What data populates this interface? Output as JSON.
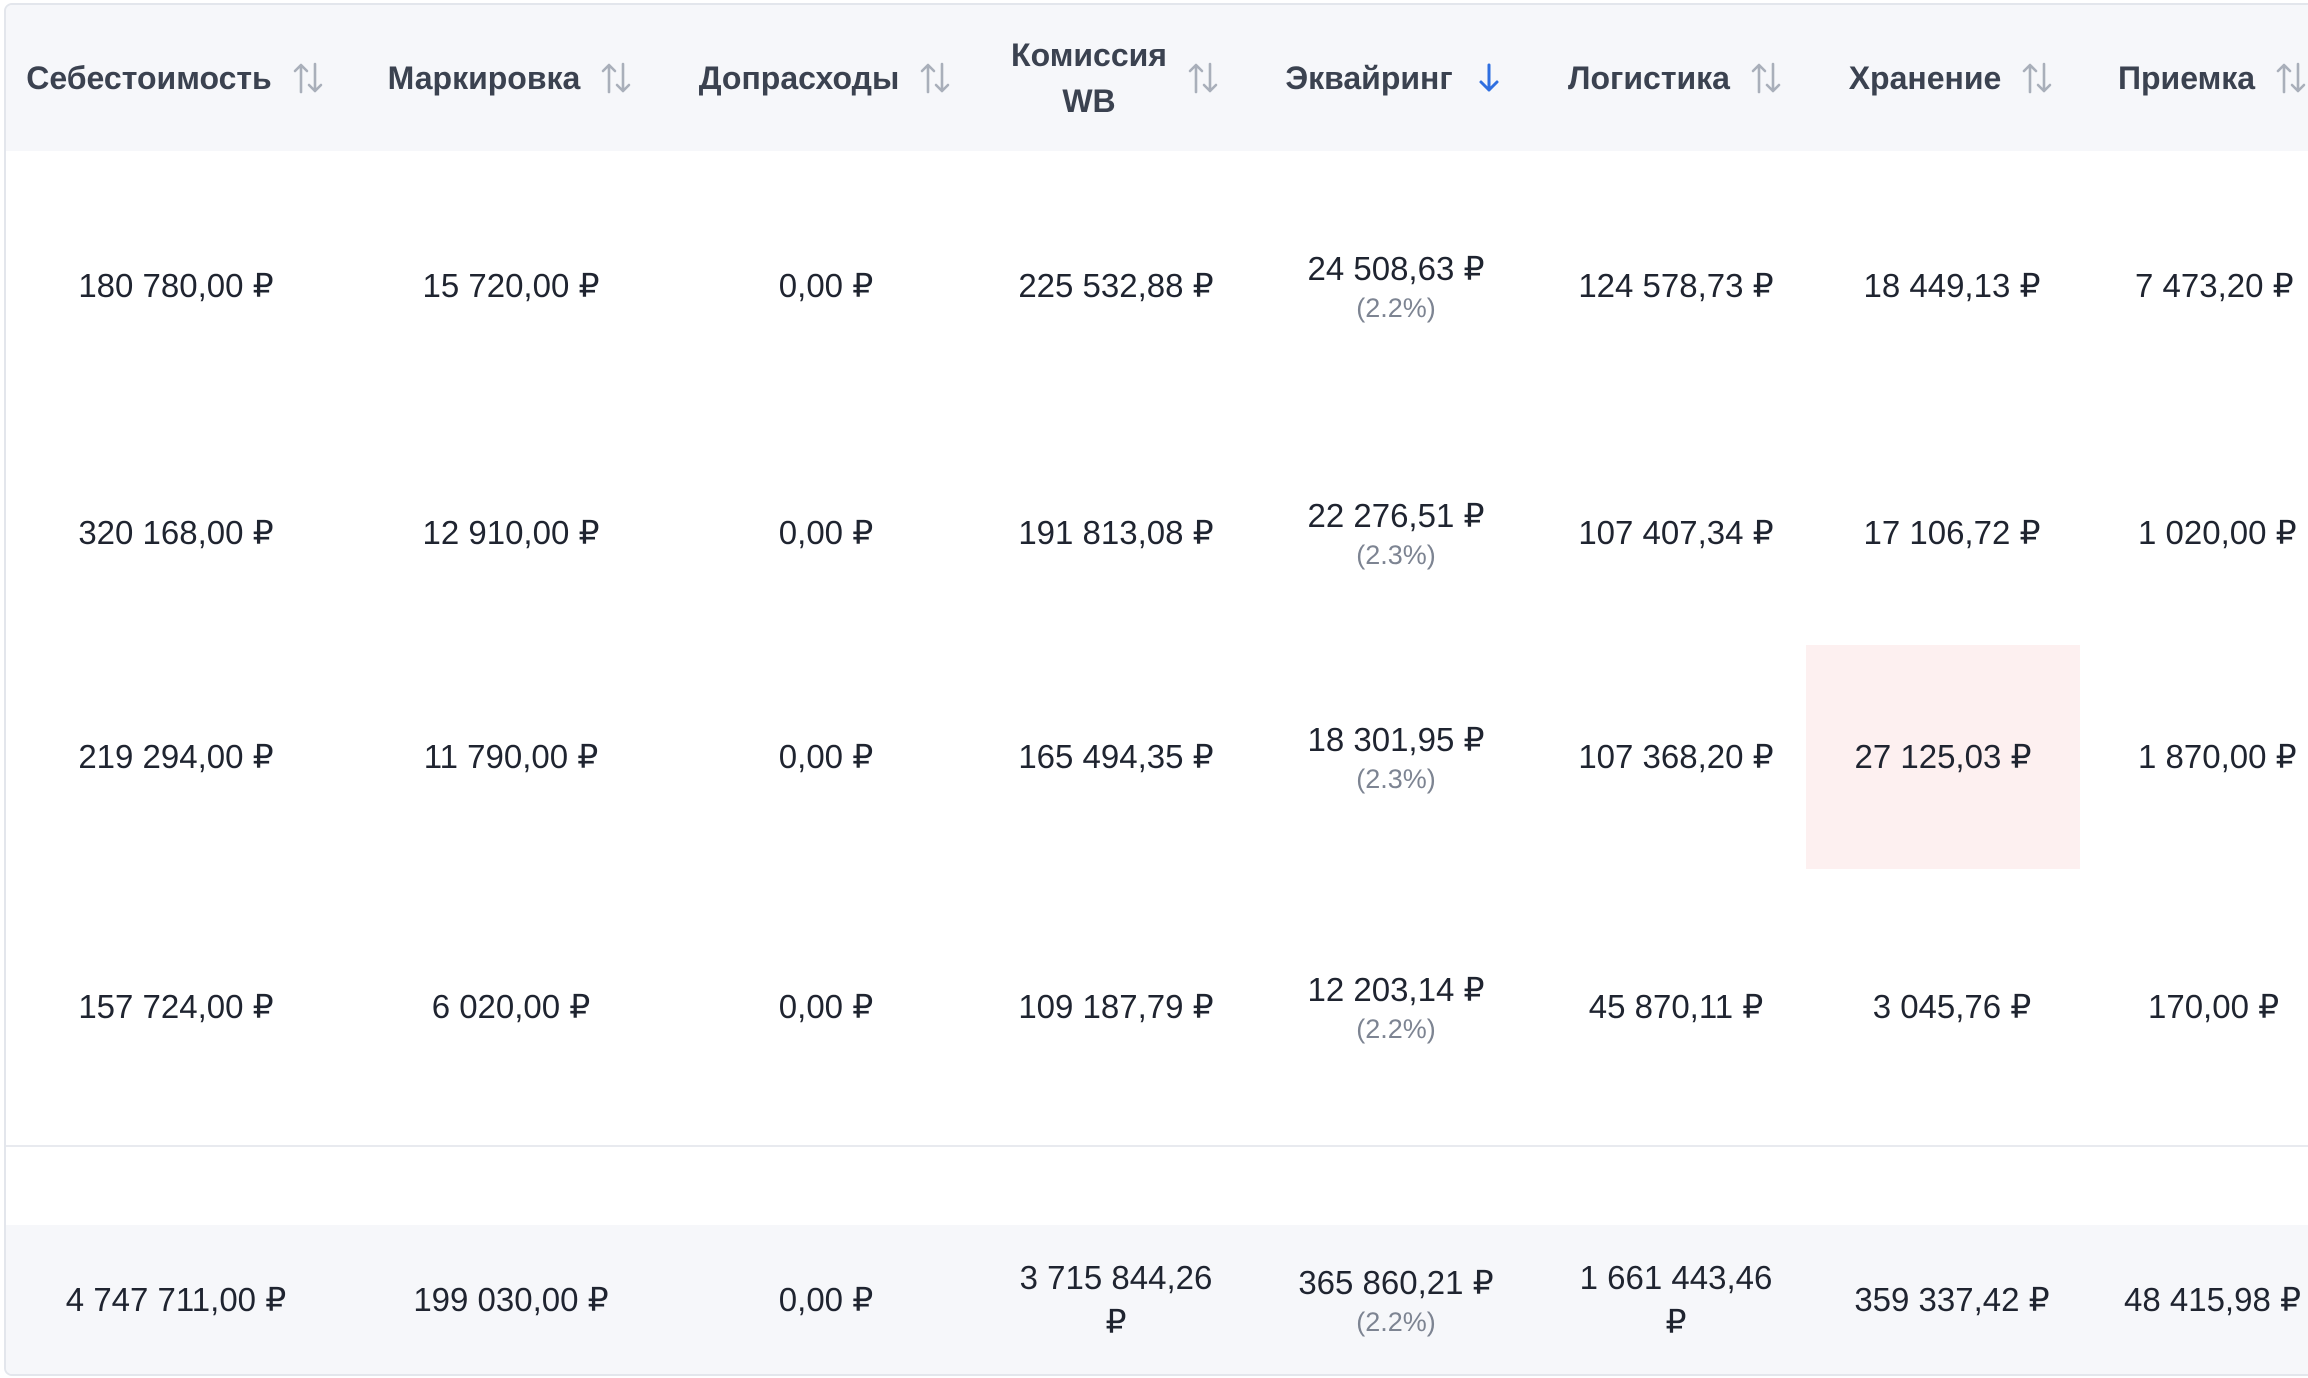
{
  "columns": [
    {
      "label": "Себестоимость",
      "sort": "none"
    },
    {
      "label": "Маркировка",
      "sort": "none"
    },
    {
      "label": "Допрасходы",
      "sort": "none"
    },
    {
      "label": "Комиссия WB",
      "label_line1": "Комиссия",
      "label_line2": "WB",
      "sort": "none"
    },
    {
      "label": "Эквайринг",
      "sort": "desc"
    },
    {
      "label": "Логистика",
      "sort": "none"
    },
    {
      "label": "Хранение",
      "sort": "none"
    },
    {
      "label": "Приемка",
      "sort": "none"
    }
  ],
  "rows": [
    {
      "cost": "180 780,00 ₽",
      "marking": "15 720,00 ₽",
      "extra": "0,00 ₽",
      "commission": "225 532,88 ₽",
      "acquiring": "24 508,63 ₽",
      "acquiring_pct": "(2.2%)",
      "logistics": "124 578,73 ₽",
      "storage": "18 449,13 ₽",
      "acceptance": "7 473,20 ₽"
    },
    {
      "cost": "320 168,00 ₽",
      "marking": "12 910,00 ₽",
      "extra": "0,00 ₽",
      "commission": "191 813,08 ₽",
      "acquiring": "22 276,51 ₽",
      "acquiring_pct": "(2.3%)",
      "logistics": "107 407,34 ₽",
      "storage": "17 106,72 ₽",
      "acceptance": "1 020,00 ₽"
    },
    {
      "cost": "219 294,00 ₽",
      "marking": "11 790,00 ₽",
      "extra": "0,00 ₽",
      "commission": "165 494,35 ₽",
      "acquiring": "18 301,95 ₽",
      "acquiring_pct": "(2.3%)",
      "logistics": "107 368,20 ₽",
      "storage": "27 125,03 ₽",
      "acceptance": "1 870,00 ₽",
      "storage_highlight_color": "#fdf0f0"
    },
    {
      "cost": "157 724,00 ₽",
      "marking": "6 020,00 ₽",
      "extra": "0,00 ₽",
      "commission": "109 187,79 ₽",
      "acquiring": "12 203,14 ₽",
      "acquiring_pct": "(2.2%)",
      "logistics": "45 870,11 ₽",
      "storage": "3 045,76 ₽",
      "acceptance": "170,00 ₽"
    }
  ],
  "totals": {
    "cost": "4 747 711,00 ₽",
    "marking": "199 030,00 ₽",
    "extra": "0,00 ₽",
    "commission_line1": "3 715 844,26",
    "commission_line2": "₽",
    "acquiring": "365 860,21 ₽",
    "acquiring_pct": "(2.2%)",
    "logistics_line1": "1 661 443,46",
    "logistics_line2": "₽",
    "storage": "359 337,42 ₽",
    "acceptance": "48 415,98 ₽"
  },
  "colors": {
    "header_bg": "#f6f7fa",
    "active_sort": "#2f6fe0",
    "inactive_sort": "#a9afba",
    "highlight": "#fdf0f0"
  }
}
